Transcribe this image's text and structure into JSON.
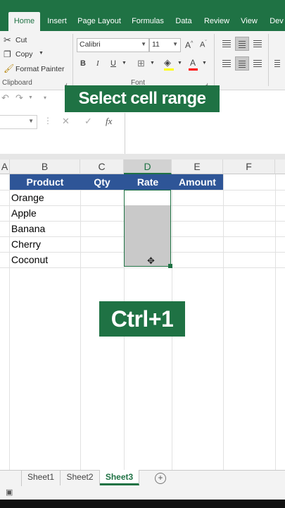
{
  "ribbon_tabs": [
    "Home",
    "Insert",
    "Page Layout",
    "Formulas",
    "Data",
    "Review",
    "View",
    "Dev"
  ],
  "clipboard": {
    "cut": "Cut",
    "copy": "Copy",
    "format_painter": "Format Painter",
    "group_label": "Clipboard"
  },
  "font": {
    "name": "Calibri",
    "size": "11",
    "group_label": "Font",
    "bold": "B",
    "italic": "I",
    "underline": "U"
  },
  "formula_bar": {
    "cancel": "✕",
    "enter": "✓",
    "fx": "fx"
  },
  "columns": [
    "A",
    "B",
    "C",
    "D",
    "E",
    "F"
  ],
  "table": {
    "headers": [
      "Product",
      "Qty",
      "Rate",
      "Amount"
    ],
    "products": [
      "Orange",
      "Apple",
      "Banana",
      "Cherry",
      "Coconut"
    ]
  },
  "overlays": {
    "top": "Select cell range",
    "middle": "Ctrl+1"
  },
  "sheets": [
    "Sheet1",
    "Sheet2",
    "Sheet3"
  ],
  "active_sheet": "Sheet3",
  "colors": {
    "excel_green": "#1f7244",
    "header_blue": "#2e5597",
    "selection_gray": "#c9c9c9"
  }
}
